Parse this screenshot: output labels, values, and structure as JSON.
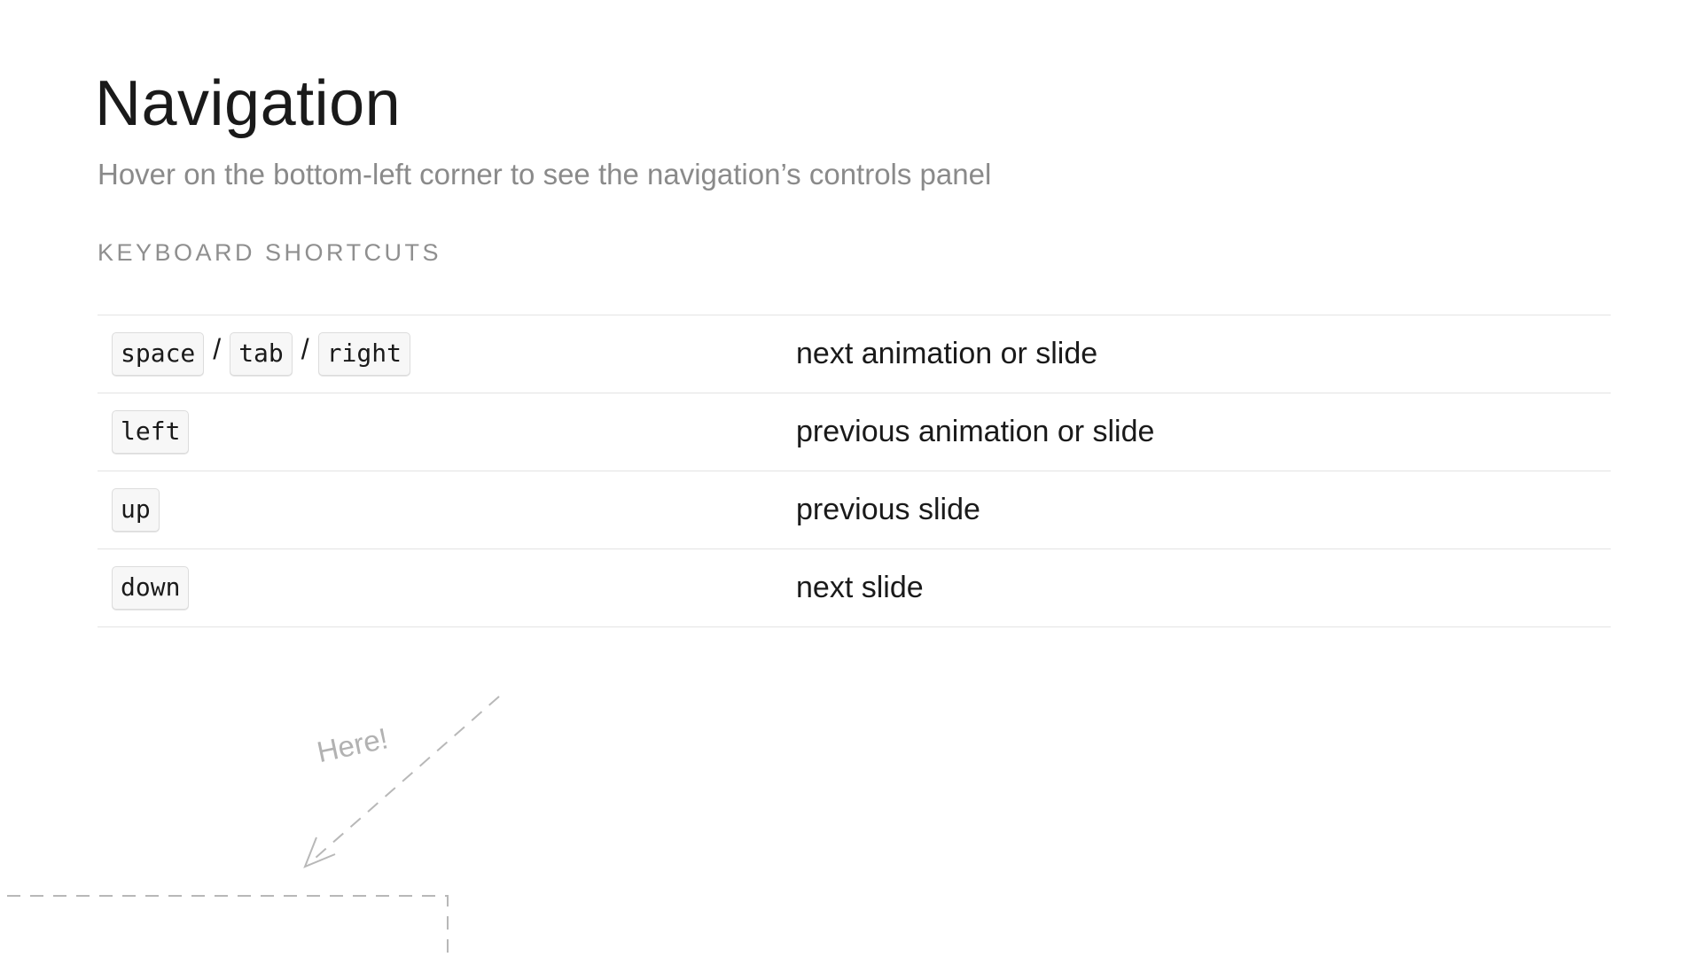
{
  "slide": {
    "title": "Navigation",
    "subtitle": "Hover on the bottom-left corner to see the navigation’s controls panel",
    "section_heading": "KEYBOARD SHORTCUTS"
  },
  "shortcuts": {
    "separator": "/",
    "rows": [
      {
        "keys": [
          "space",
          "tab",
          "right"
        ],
        "description": "next animation or slide"
      },
      {
        "keys": [
          "left"
        ],
        "description": "previous animation or slide"
      },
      {
        "keys": [
          "up"
        ],
        "description": "previous slide"
      },
      {
        "keys": [
          "down"
        ],
        "description": "next slide"
      }
    ]
  },
  "hint": {
    "label": "Here!"
  },
  "colors": {
    "text": "#1a1a1a",
    "muted": "#8a8a8a",
    "rule": "#e3e3e3",
    "hint": "#b2b2b2"
  }
}
